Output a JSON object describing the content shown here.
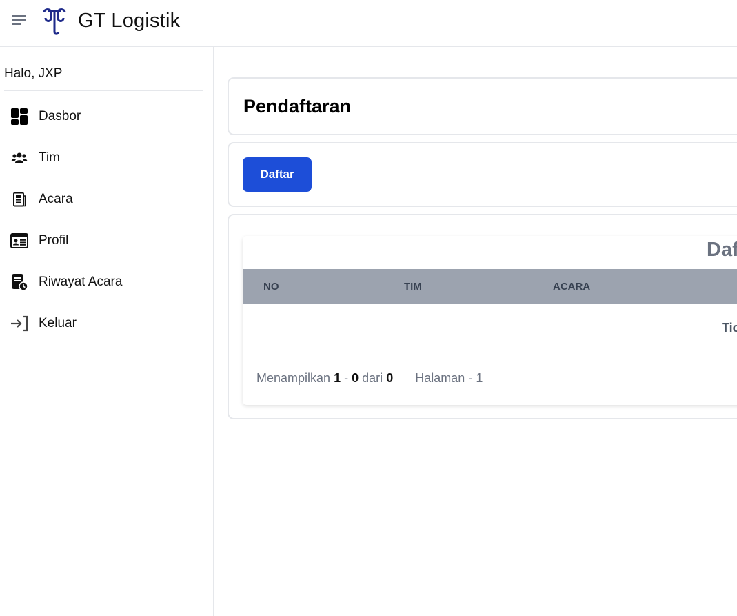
{
  "app": {
    "brand": "GT Logistik",
    "accent_color": "#1d4ed8",
    "logo_name": "gt-logo-mark"
  },
  "sidebar": {
    "greeting": "Halo, JXP",
    "items": [
      {
        "label": "Dasbor",
        "icon": "dashboard-icon"
      },
      {
        "label": "Tim",
        "icon": "team-icon"
      },
      {
        "label": "Acara",
        "icon": "event-icon"
      },
      {
        "label": "Profil",
        "icon": "profile-card-icon"
      },
      {
        "label": "Riwayat Acara",
        "icon": "history-icon"
      },
      {
        "label": "Keluar",
        "icon": "logout-icon"
      }
    ]
  },
  "main": {
    "page_title": "Pendaftaran",
    "register_button": "Daftar",
    "table": {
      "title": "Daf",
      "columns": [
        "NO",
        "TIM",
        "ACARA"
      ],
      "empty_text": "Tic",
      "pagination": {
        "showing_label": "Menampilkan",
        "from": "1",
        "dash": "-",
        "to": "0",
        "of_label": "dari",
        "total": "0",
        "page_label": "Halaman",
        "page_dash": "-",
        "page": "1"
      }
    }
  }
}
